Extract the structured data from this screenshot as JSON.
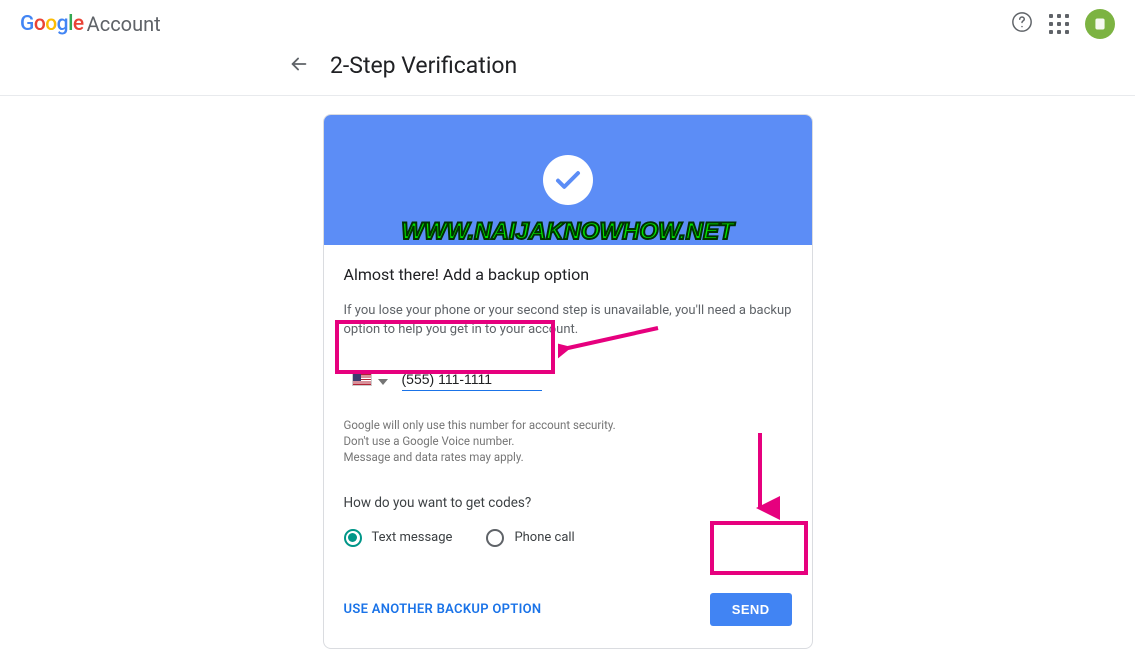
{
  "header": {
    "logo_text": "Google",
    "account_text": "Account"
  },
  "page": {
    "title": "2-Step Verification"
  },
  "watermark": "WWW.NAIJAKNOWHOW.NET",
  "card": {
    "heading": "Almost there! Add a backup option",
    "description": "If you lose your phone or your second step is unavailable, you'll need a backup option to help you get in to your account.",
    "phone_value": "(555) 111-1111",
    "fine_print_1": "Google will only use this number for account security.",
    "fine_print_2": "Don't use a Google Voice number.",
    "fine_print_3": "Message and data rates may apply.",
    "how_question": "How do you want to get codes?",
    "radio_text": "Text message",
    "radio_call": "Phone call",
    "alt_link": "USE ANOTHER BACKUP OPTION",
    "send_label": "SEND"
  }
}
